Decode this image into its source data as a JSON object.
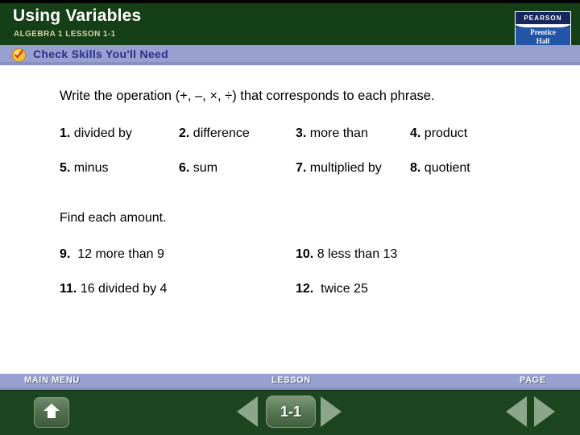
{
  "header": {
    "title": "Using Variables",
    "subtitle": "ALGEBRA 1  LESSON 1-1",
    "green": "#153F17",
    "logo": {
      "top_text": "PEARSON",
      "bottom_line1": "Prentice",
      "bottom_line2": "Hall",
      "navy": "#18275e",
      "blue": "#2255a8"
    }
  },
  "skills_bar": {
    "label": "Check Skills You'll Need",
    "icon": "check-badge-icon",
    "background": "#98A0CF",
    "text_color": "#2B2F8C"
  },
  "content": {
    "prompt": "Write the operation (+, –, ×, ÷) that corresponds to each phrase.",
    "phrase_items": [
      {
        "num": "1.",
        "text": "divided by"
      },
      {
        "num": "2.",
        "text": "difference"
      },
      {
        "num": "3.",
        "text": "more than"
      },
      {
        "num": "4.",
        "text": "product"
      },
      {
        "num": "5.",
        "text": "minus"
      },
      {
        "num": "6.",
        "text": "sum"
      },
      {
        "num": "7.",
        "text": "multiplied by"
      },
      {
        "num": "8.",
        "text": "quotient"
      }
    ],
    "section_head": "Find each amount.",
    "amount_items": [
      {
        "num": "9.",
        "text": "12 more than 9"
      },
      {
        "num": "10.",
        "text": "8 less than 13"
      },
      {
        "num": "11.",
        "text": "16 divided by 4"
      },
      {
        "num": "12.",
        "text": "twice 25"
      }
    ]
  },
  "footer": {
    "bar_color": "#98A0CF",
    "panel_color": "#1C4520",
    "main_menu_label": "MAIN MENU",
    "lesson_label": "LESSON",
    "page_label": "PAGE",
    "lesson_number": "1-1",
    "home_icon": "home-up-arrow-icon",
    "prev_icon": "triangle-left-icon",
    "next_icon": "triangle-right-icon"
  }
}
